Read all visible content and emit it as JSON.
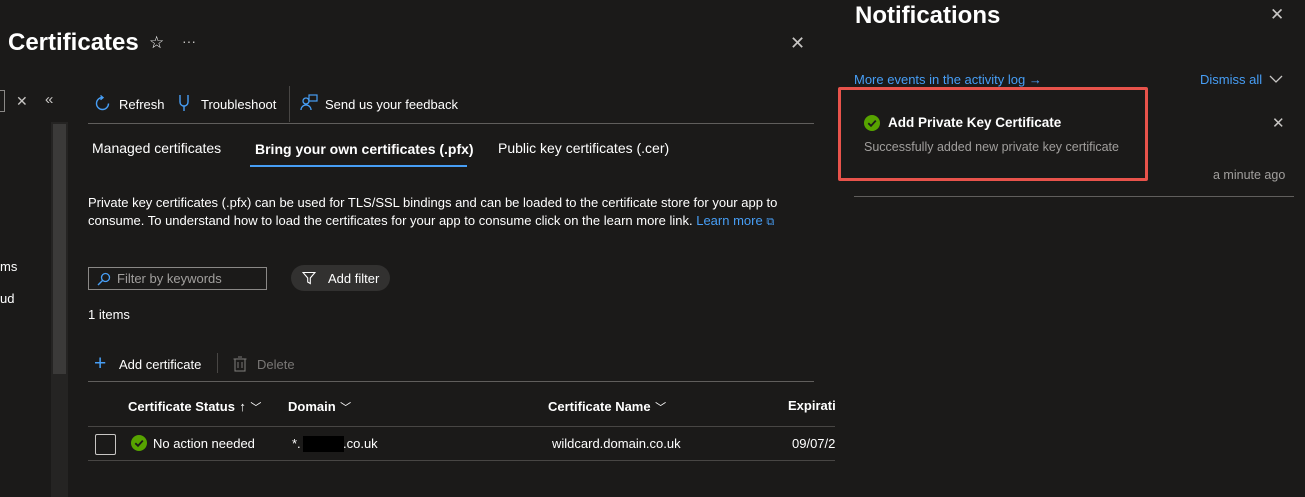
{
  "window": {
    "title": "Certificates"
  },
  "left_nav": {
    "partial_items": [
      "ms",
      "ud"
    ]
  },
  "toolbar": {
    "refresh_label": "Refresh",
    "troubleshoot_label": "Troubleshoot",
    "feedback_label": "Send us your feedback"
  },
  "tabs": [
    {
      "label": "Managed certificates",
      "active": false
    },
    {
      "label": "Bring your own certificates (.pfx)",
      "active": true
    },
    {
      "label": "Public key certificates (.cer)",
      "active": false
    }
  ],
  "description": {
    "line1": "Private key certificates (.pfx) can be used for TLS/SSL bindings and can be loaded to the certificate store for your app to",
    "line2": "consume. To understand how to load the certificates for your app to consume click on the learn more link.",
    "learn_more": "Learn more"
  },
  "filter": {
    "placeholder": "Filter by keywords",
    "add_filter_label": "Add filter"
  },
  "items_count": "1 items",
  "table_commands": {
    "add_label": "Add certificate",
    "delete_label": "Delete"
  },
  "table": {
    "columns": [
      "Certificate Status",
      "Domain",
      "Certificate Name",
      "Expiratio"
    ],
    "sort_indicator": "↑",
    "rows": [
      {
        "status": "No action needed",
        "domain_prefix": "*.",
        "domain_suffix": ".co.uk",
        "name": "wildcard.domain.co.uk",
        "expiration": "09/07/2"
      }
    ]
  },
  "notifications": {
    "title": "Notifications",
    "activity_log_link": "More events in the activity log →",
    "dismiss_all": "Dismiss all",
    "items": [
      {
        "title": "Add Private Key Certificate",
        "message": "Successfully added new private key certificate",
        "time": "a minute ago"
      }
    ]
  },
  "colors": {
    "background": "#1b1a19",
    "accent_link": "#479ef5",
    "success": "#57a300",
    "highlight": "#e8534b"
  }
}
